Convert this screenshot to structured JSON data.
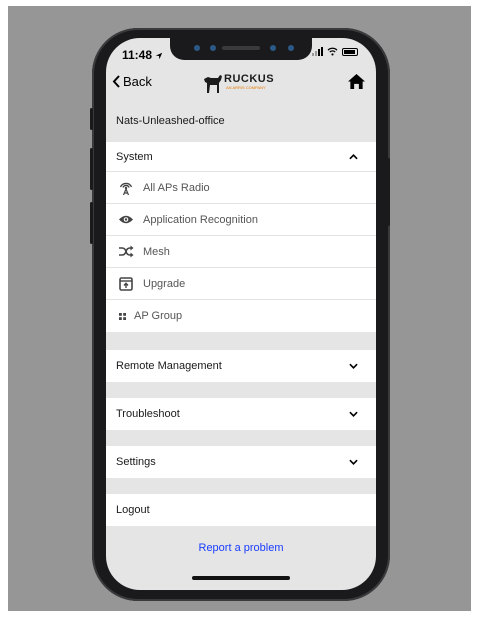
{
  "status": {
    "time": "11:48"
  },
  "nav": {
    "back_label": "Back",
    "logo_text": "RUCKUS",
    "logo_subtext": "AN ARRIS COMPANY"
  },
  "account": {
    "name": "Nats-Unleashed-office"
  },
  "system": {
    "label": "System",
    "items": [
      {
        "label": "All APs Radio",
        "icon": "antenna-icon"
      },
      {
        "label": "Application Recognition",
        "icon": "eye-icon"
      },
      {
        "label": "Mesh",
        "icon": "shuffle-icon"
      },
      {
        "label": "Upgrade",
        "icon": "upgrade-icon"
      },
      {
        "label": "AP Group",
        "icon": "grid-dots-icon"
      }
    ]
  },
  "sections": {
    "remote": "Remote Management",
    "troubleshoot": "Troubleshoot",
    "settings": "Settings"
  },
  "logout": "Logout",
  "report": "Report a problem",
  "colors": {
    "link": "#1a3cff",
    "background": "#e5e5e5",
    "row": "#ffffff"
  }
}
